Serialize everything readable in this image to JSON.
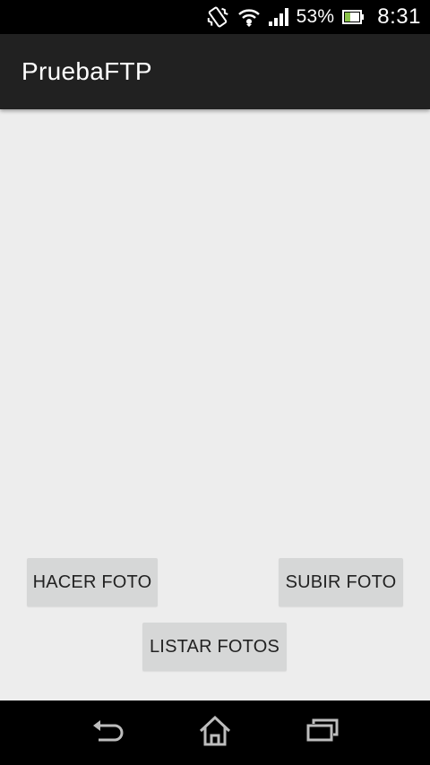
{
  "status_bar": {
    "battery_percent": "53%",
    "time": "8:31",
    "icons": [
      "vibrate-icon",
      "wifi-icon",
      "signal-icon",
      "battery-icon"
    ]
  },
  "action_bar": {
    "title": "PruebaFTP"
  },
  "buttons": {
    "hacer_foto": "HACER FOTO",
    "subir_foto": "SUBIR FOTO",
    "listar_fotos": "LISTAR FOTOS"
  },
  "nav_bar": {
    "icons": [
      "back-icon",
      "home-icon",
      "recent-apps-icon"
    ]
  },
  "colors": {
    "status_bar": "#000000",
    "action_bar": "#212121",
    "background": "#ededed",
    "button": "#d6d7d7",
    "battery_fill": "#8bc34a"
  }
}
